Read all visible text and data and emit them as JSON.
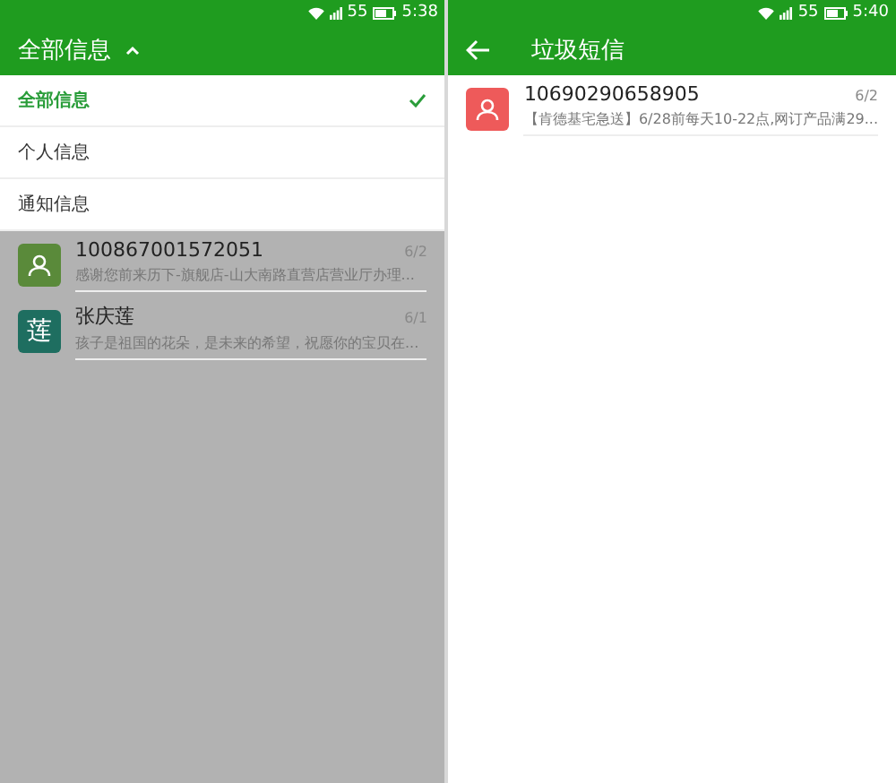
{
  "screens": [
    {
      "status_bar": {
        "network": "55",
        "time": "5:38"
      },
      "header": {
        "title": "全部信息",
        "kind": "dropdown"
      },
      "dropdown": {
        "expanded": true,
        "items": [
          {
            "label": "全部信息",
            "selected": true
          },
          {
            "label": "个人信息",
            "selected": false
          },
          {
            "label": "通知信息",
            "selected": false
          }
        ]
      },
      "messages": [
        {
          "sender": "100867001572051",
          "preview": "感谢您前来历下-旗舰店-山大南路直营店营业厅办理...",
          "date": "6/2",
          "avatar": {
            "kind": "person",
            "color": "#5a8a3a"
          }
        },
        {
          "sender": "张庆莲",
          "preview": "孩子是祖国的花朵，是未来的希望，祝愿你的宝贝在...",
          "date": "6/1",
          "avatar": {
            "kind": "letter",
            "text": "莲",
            "color": "#1e6e60"
          }
        }
      ]
    },
    {
      "status_bar": {
        "network": "55",
        "time": "5:40"
      },
      "header": {
        "title": "垃圾短信",
        "kind": "back"
      },
      "messages": [
        {
          "sender": "10690290658905",
          "preview": "【肯德基宅急送】6/28前每天10-22点,网订产品满29...",
          "date": "6/2",
          "avatar": {
            "kind": "person",
            "color": "#ee5a5a"
          }
        }
      ]
    }
  ]
}
